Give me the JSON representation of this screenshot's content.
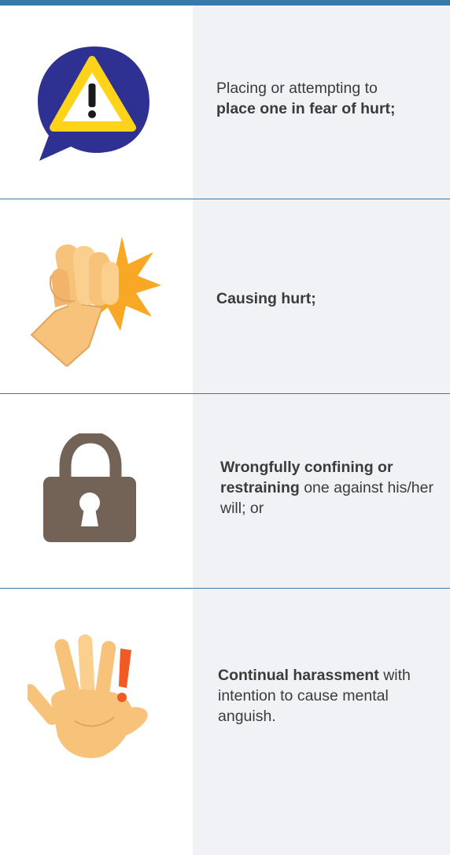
{
  "items": [
    {
      "icon": "warning-speech-bubble-icon",
      "normal_before": "Placing or attempting to",
      "bold": "place one in fear of hurt;",
      "normal_after": ""
    },
    {
      "icon": "fist-punch-icon",
      "normal_before": "",
      "bold": "Causing hurt;",
      "normal_after": ""
    },
    {
      "icon": "padlock-icon",
      "normal_before": "",
      "bold": "Wrongfully confining or restraining",
      "normal_after": " one against his/her will; or"
    },
    {
      "icon": "raised-hand-exclamation-icon",
      "normal_before": "",
      "bold": "Continual harassment",
      "normal_after": " with intention to cause mental anguish."
    }
  ],
  "colors": {
    "accent": "#3a78a8",
    "panel": "#f0f2f5",
    "text": "#3b3b3b",
    "bubble": "#2e3192",
    "warning": "#ffd31a",
    "lock": "#736357",
    "skin": "#f7c27a",
    "burst": "#f9a825",
    "alert": "#f15a24"
  }
}
